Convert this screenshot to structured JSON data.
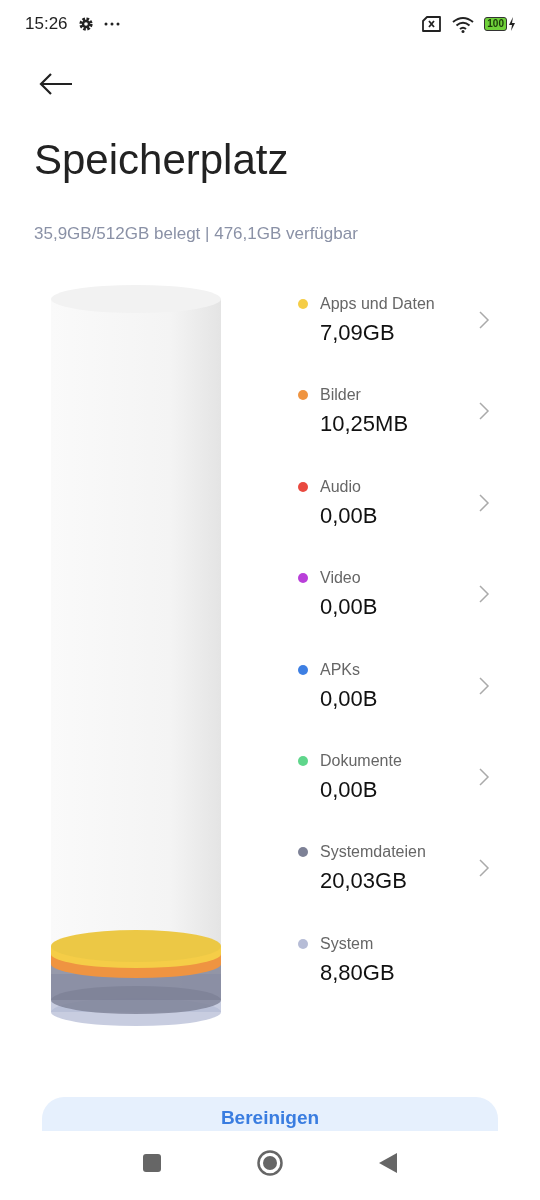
{
  "status_bar": {
    "time": "15:26",
    "battery": "100"
  },
  "title": "Speicherplatz",
  "summary": "35,9GB/512GB belegt | 476,1GB verfügbar",
  "categories": [
    {
      "label": "Apps und Daten",
      "value": "7,09GB",
      "color": "#f5cd47",
      "navigable": true
    },
    {
      "label": "Bilder",
      "value": "10,25MB",
      "color": "#ef9441",
      "navigable": true
    },
    {
      "label": "Audio",
      "value": "0,00B",
      "color": "#e9493f",
      "navigable": true
    },
    {
      "label": "Video",
      "value": "0,00B",
      "color": "#b93fd9",
      "navigable": true
    },
    {
      "label": "APKs",
      "value": "0,00B",
      "color": "#3d7fe3",
      "navigable": true
    },
    {
      "label": "Dokumente",
      "value": "0,00B",
      "color": "#5fd68b",
      "navigable": true
    },
    {
      "label": "Systemdateien",
      "value": "20,03GB",
      "color": "#7d8196",
      "navigable": true
    },
    {
      "label": "System",
      "value": "8,80GB",
      "color": "#b6bcd6",
      "navigable": false
    }
  ],
  "clean_button": "Bereinigen"
}
